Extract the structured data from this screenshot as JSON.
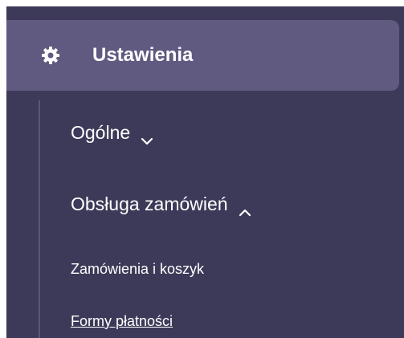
{
  "sidebar": {
    "section": {
      "icon": "gear-icon",
      "title": "Ustawienia"
    },
    "items": [
      {
        "label": "Ogólne",
        "expanded": false,
        "icon": "chevron-down-icon"
      },
      {
        "label": "Obsługa zamówień",
        "expanded": true,
        "icon": "chevron-up-icon"
      }
    ],
    "subitems": [
      {
        "label": "Zamówienia i koszyk",
        "active": false
      },
      {
        "label": "Formy płatności",
        "active": true
      }
    ]
  },
  "colors": {
    "sidebar_bg": "#3c3a58",
    "section_active_bg": "#605a81",
    "text": "#ffffff",
    "tree_line": "#5a5777"
  }
}
